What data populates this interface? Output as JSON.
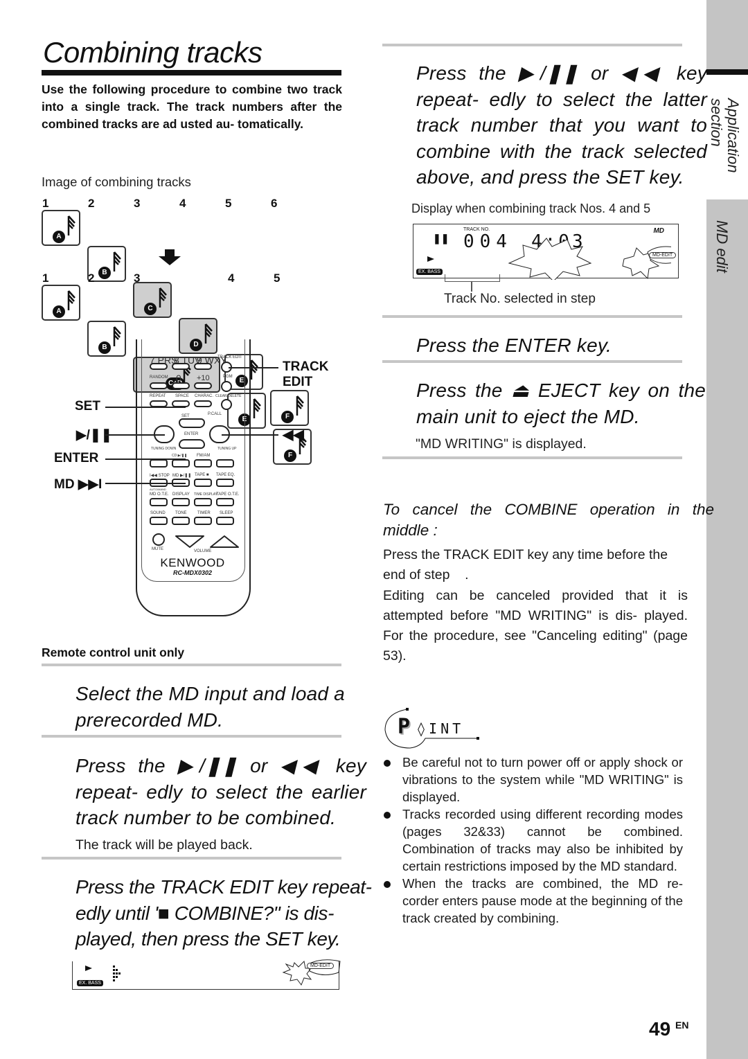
{
  "page": {
    "title": "Combining tracks",
    "intro": "Use the following procedure to combine two track into a single track. The track numbers after the combined tracks are ad usted au- tomatically.",
    "page_number": "49",
    "page_lang": "EN"
  },
  "sidebar": {
    "section_label": "Application section",
    "chapter_label": "MD edit"
  },
  "diagram": {
    "caption": "Image of combining tracks",
    "before": [
      {
        "num": "1",
        "letter": "A",
        "highlighted": false
      },
      {
        "num": "2",
        "letter": "B",
        "highlighted": false
      },
      {
        "num": "3",
        "letter": "C",
        "highlighted": true
      },
      {
        "num": "4",
        "letter": "D",
        "highlighted": true
      },
      {
        "num": "5",
        "letter": "E",
        "highlighted": false
      },
      {
        "num": "6",
        "letter": "F",
        "highlighted": false
      }
    ],
    "after": [
      {
        "num": "1",
        "letter": "A",
        "highlighted": false
      },
      {
        "num": "2",
        "letter": "B",
        "highlighted": false
      },
      {
        "num": "3",
        "letter": "C+D",
        "highlighted": true
      },
      {
        "num": "4",
        "letter": "E",
        "highlighted": false
      },
      {
        "num": "5",
        "letter": "F",
        "highlighted": false
      }
    ]
  },
  "remote": {
    "callouts_left": [
      "SET",
      "▶/❚❚",
      "ENTER",
      "MD ▶▶I"
    ],
    "callouts_right": [
      "TRACK EDIT",
      "◀◀"
    ],
    "track_edit_line1": "TRACK",
    "track_edit_line2": "EDIT",
    "rewind_label": "◀◀",
    "keys_row1": [
      "7 PRS",
      "8 TUV",
      "9 WXY",
      "TRACK EDIT"
    ],
    "keys_row2": [
      "RANDOM",
      "0",
      "+10",
      "PGM"
    ],
    "keys_row3": [
      "REPEAT",
      "SPACE",
      "CHARAC.",
      "CLEAR/DELETE"
    ],
    "nav_labels": {
      "set": "SET",
      "pcall": "P.CALL",
      "enter": "ENTER",
      "tuning_down": "TUNING DOWN",
      "tuning_up": "TUNING UP"
    },
    "keys_row4": [
      "CD ▶/❚❚",
      "FM/AM"
    ],
    "keys_row5": [
      "I◀◀ STOP",
      "MD ▶/❚❚",
      "TAPE ■",
      "TAPE EQ."
    ],
    "auto_label": "AUTO/MAND",
    "keys_row6": [
      "MD O.T.E.",
      "DISPLAY",
      "TIME DISPLAY",
      "TAPE O.T.E."
    ],
    "keys_row7": [
      "SOUND",
      "TONE",
      "TIMER",
      "SLEEP"
    ],
    "mute": "MUTE",
    "volume": "VOLUME",
    "brand": "KENWOOD",
    "model": "RC-MDX0302",
    "caption": "Remote control unit only"
  },
  "steps_left": [
    {
      "text": "Select the MD input and load a prerecorded MD.",
      "sub": ""
    },
    {
      "text": "Press the ▶/❚❚ or ◀◀ key repeat- edly to select the earlier track number to be combined.",
      "sub": "The track will be played back."
    },
    {
      "text": "Press the TRACK EDIT key repeat- edly until '■ COMBINE?\" is dis- played, then press the SET key.",
      "sub": ""
    }
  ],
  "bottom_display": {
    "exbass": "EX. BASS",
    "mdedit": "MD-EDIT"
  },
  "steps_right": [
    {
      "text": "Press the ▶/❚❚ or ◀◀ key repeat- edly to select the latter track number that you want to combine with the track selected above, and press the SET key.",
      "sub": "Display when combining track Nos. 4 and 5"
    },
    {
      "text": "Press the ENTER key.",
      "sub": ""
    },
    {
      "text": "Press the ⏏ EJECT key on the main unit to eject the MD.",
      "sub": "\"MD WRITING\" is displayed."
    }
  ],
  "display": {
    "track_no_label": "TRACK NO.",
    "pause_icon": "❚❚",
    "track_digits": "004",
    "time": "4:03",
    "md_logo": "MD",
    "exbass": "EX. BASS",
    "mdedit": "MD-EDIT",
    "annotation": "Track No. selected in step"
  },
  "cancel": {
    "heading": "To cancel the COMBINE operation in the middle :",
    "para1": "Press the TRACK EDIT key any time before the end of step    .",
    "para2": "Editing can be canceled provided that it is attempted before \"MD WRITING\" is dis- played. For the procedure, see \"Canceling editing\" (page 53)."
  },
  "point": {
    "logo_p": "P",
    "logo_rest": "◊INT",
    "items": [
      "Be careful not to turn power off or apply shock or vibrations to the system while \"MD WRITING\" is displayed.",
      "Tracks recorded using different recording modes (pages 32&33) cannot be combined. Combination of tracks may also be inhibited by certain restrictions imposed by the MD standard.",
      "When the tracks are combined, the MD re- corder enters pause mode at the beginning of the track created by combining."
    ]
  }
}
